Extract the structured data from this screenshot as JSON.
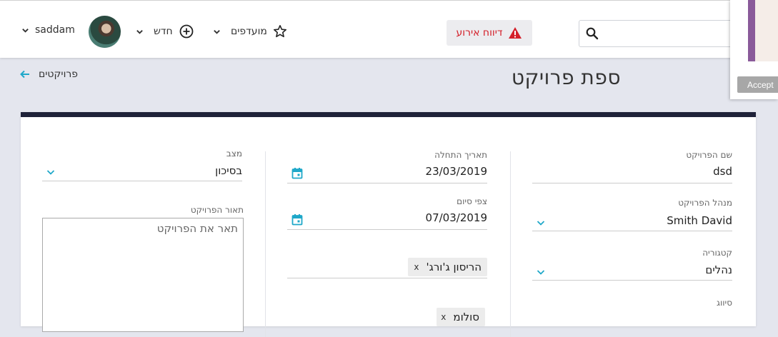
{
  "header": {
    "username": "saddam",
    "new_label": "חדש",
    "favorites_label": "מועדפים",
    "report_label": "דיווח אירוע",
    "search_placeholder": ""
  },
  "popup": {
    "accept_label": "Accept"
  },
  "page": {
    "title": "ספת פרויקט",
    "back_label": "פרויקטים"
  },
  "form": {
    "project_name": {
      "label": "שם הפרויקט",
      "value": "dsd"
    },
    "project_manager": {
      "label": "מנהל הפרויקט",
      "value": "Smith David"
    },
    "category": {
      "label": "קטגוריה",
      "value": "נהלים"
    },
    "classification": {
      "label": "סיווג"
    },
    "start_date": {
      "label": "תאריך התחלה",
      "value": "23/03/2019"
    },
    "end_date": {
      "label": "צפי סיום",
      "value": "07/03/2019"
    },
    "members": [
      {
        "name": "הריסון ג'ורג'",
        "remove": "x"
      },
      {
        "name": "סולומ",
        "remove": "x"
      }
    ],
    "status": {
      "label": "מצב",
      "value": "בסיכון"
    },
    "description": {
      "label": "תאור הפרויקט",
      "placeholder": "תאר את הפרויקט"
    }
  },
  "colors": {
    "accent": "#1fa8c9",
    "report_red": "#d4202a",
    "card_top": "#1f2239",
    "page_bg": "#e4e6ee"
  },
  "icons": {
    "search": "search-icon",
    "alert": "warning-icon",
    "plus": "plus-circle-icon",
    "star": "star-icon",
    "chevron": "chevron-down-icon",
    "calendar": "calendar-icon",
    "back": "arrow-left-icon"
  }
}
